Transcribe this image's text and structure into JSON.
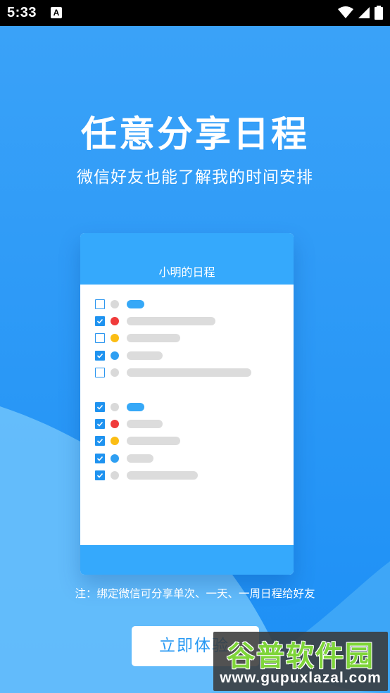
{
  "status_bar": {
    "time": "5:33",
    "a_icon_label": "A"
  },
  "onboarding": {
    "title": "任意分享日程",
    "subtitle": "微信好友也能了解我的时间安排",
    "note": "注：绑定微信可分享单次、一天、一周日程给好友",
    "cta_label": "立即体验"
  },
  "card": {
    "title": "小明的日程",
    "group_1": [
      {
        "checked": false,
        "dot_color": "#d9d9d9",
        "bar_color": "#36a8f7"
      },
      {
        "checked": true,
        "dot_color": "#f03b3b",
        "bar_color": "#dcdcdc"
      },
      {
        "checked": false,
        "dot_color": "#fbbd14",
        "bar_color": "#dcdcdc"
      },
      {
        "checked": true,
        "dot_color": "#2f9ff2",
        "bar_color": "#dcdcdc"
      },
      {
        "checked": false,
        "dot_color": "#d9d9d9",
        "bar_color": "#dcdcdc"
      }
    ],
    "group_2": [
      {
        "checked": true,
        "dot_color": "#d9d9d9",
        "bar_color": "#36a8f7"
      },
      {
        "checked": true,
        "dot_color": "#f03b3b",
        "bar_color": "#dcdcdc"
      },
      {
        "checked": true,
        "dot_color": "#fbbd14",
        "bar_color": "#dcdcdc"
      },
      {
        "checked": true,
        "dot_color": "#2f9ff2",
        "bar_color": "#dcdcdc"
      },
      {
        "checked": true,
        "dot_color": "#d9d9d9",
        "bar_color": "#dcdcdc"
      }
    ]
  },
  "watermark": {
    "title": "谷普软件园",
    "url": "www.gupuxlazal.com"
  },
  "colors": {
    "accent": "#2a9af3",
    "card_header": "#35a9fc"
  }
}
